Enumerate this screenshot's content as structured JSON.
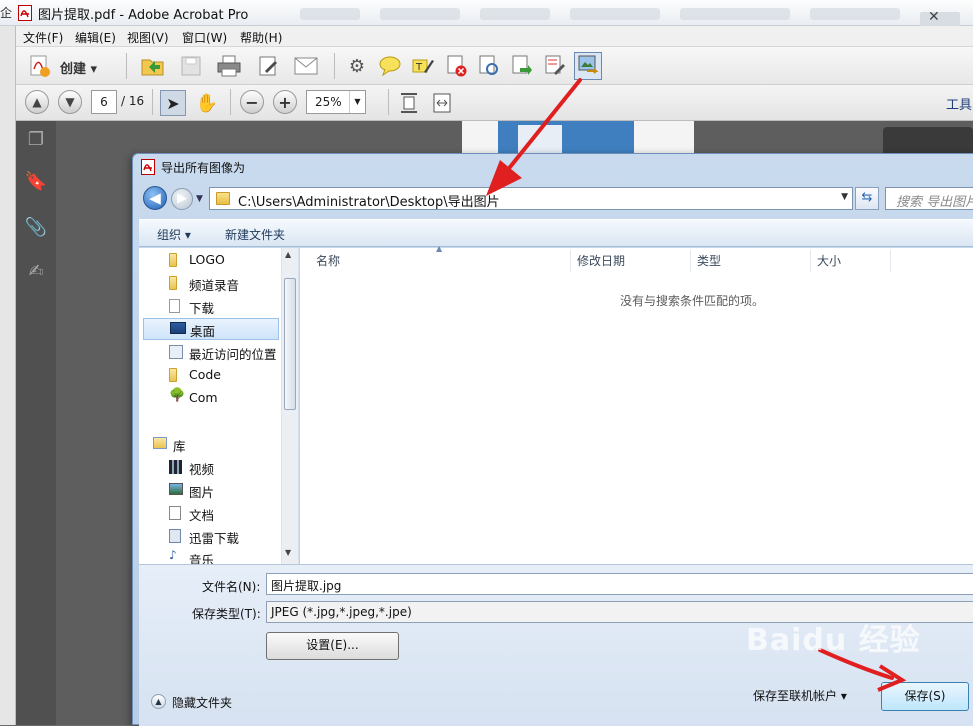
{
  "app": {
    "title": "图片提取.pdf - Adobe Acrobat Pro",
    "left_glyph": "企"
  },
  "menu": [
    "文件(F)",
    "编辑(E)",
    "视图(V)",
    "窗口(W)",
    "帮助(H)"
  ],
  "toolbar": {
    "create_label": "创建 ▾"
  },
  "pagenav": {
    "current_page": "6",
    "total_pages": "/ 16",
    "zoom": "25%",
    "tools_label": "工具"
  },
  "dialog": {
    "title": "导出所有图像为",
    "address_path": "C:\\Users\\Administrator\\Desktop\\导出图片",
    "search_placeholder": "搜索 导出图片",
    "organize_label": "组织 ▾",
    "new_folder_label": "新建文件夹",
    "tree_items": [
      {
        "label": "LOGO",
        "icon": "folder-icon"
      },
      {
        "label": "频道录音",
        "icon": "folder-icon"
      },
      {
        "label": "下载",
        "icon": "document-icon"
      },
      {
        "label": "桌面",
        "icon": "desktop-icon",
        "selected": true
      },
      {
        "label": "最近访问的位置",
        "icon": "recent-places-icon"
      },
      {
        "label": "Code",
        "icon": "folder-icon"
      },
      {
        "label": "Com",
        "icon": "network-tree-icon"
      }
    ],
    "library_label": "库",
    "library_items": [
      {
        "label": "视频",
        "icon": "video-library-icon"
      },
      {
        "label": "图片",
        "icon": "picture-library-icon"
      },
      {
        "label": "文档",
        "icon": "document-library-icon"
      },
      {
        "label": "迅雷下载",
        "icon": "download-library-icon"
      },
      {
        "label": "音乐",
        "icon": "music-library-icon"
      }
    ],
    "columns": [
      "名称",
      "修改日期",
      "类型",
      "大小"
    ],
    "empty_message": "没有与搜索条件匹配的项。",
    "filename_label": "文件名(N):",
    "filename_value": "图片提取.jpg",
    "filetype_label": "保存类型(T):",
    "filetype_value": "JPEG (*.jpg,*.jpeg,*.jpe)",
    "settings_button": "设置(E)...",
    "hide_folders_label": "隐藏文件夹",
    "save_option_label": "保存至联机帐户 ▾",
    "save_button": "保存(S)"
  },
  "watermark": "Baidu 经验",
  "colors": {
    "annotation_arrow": "#e02020",
    "dialog_frame": "#b8cde6"
  }
}
